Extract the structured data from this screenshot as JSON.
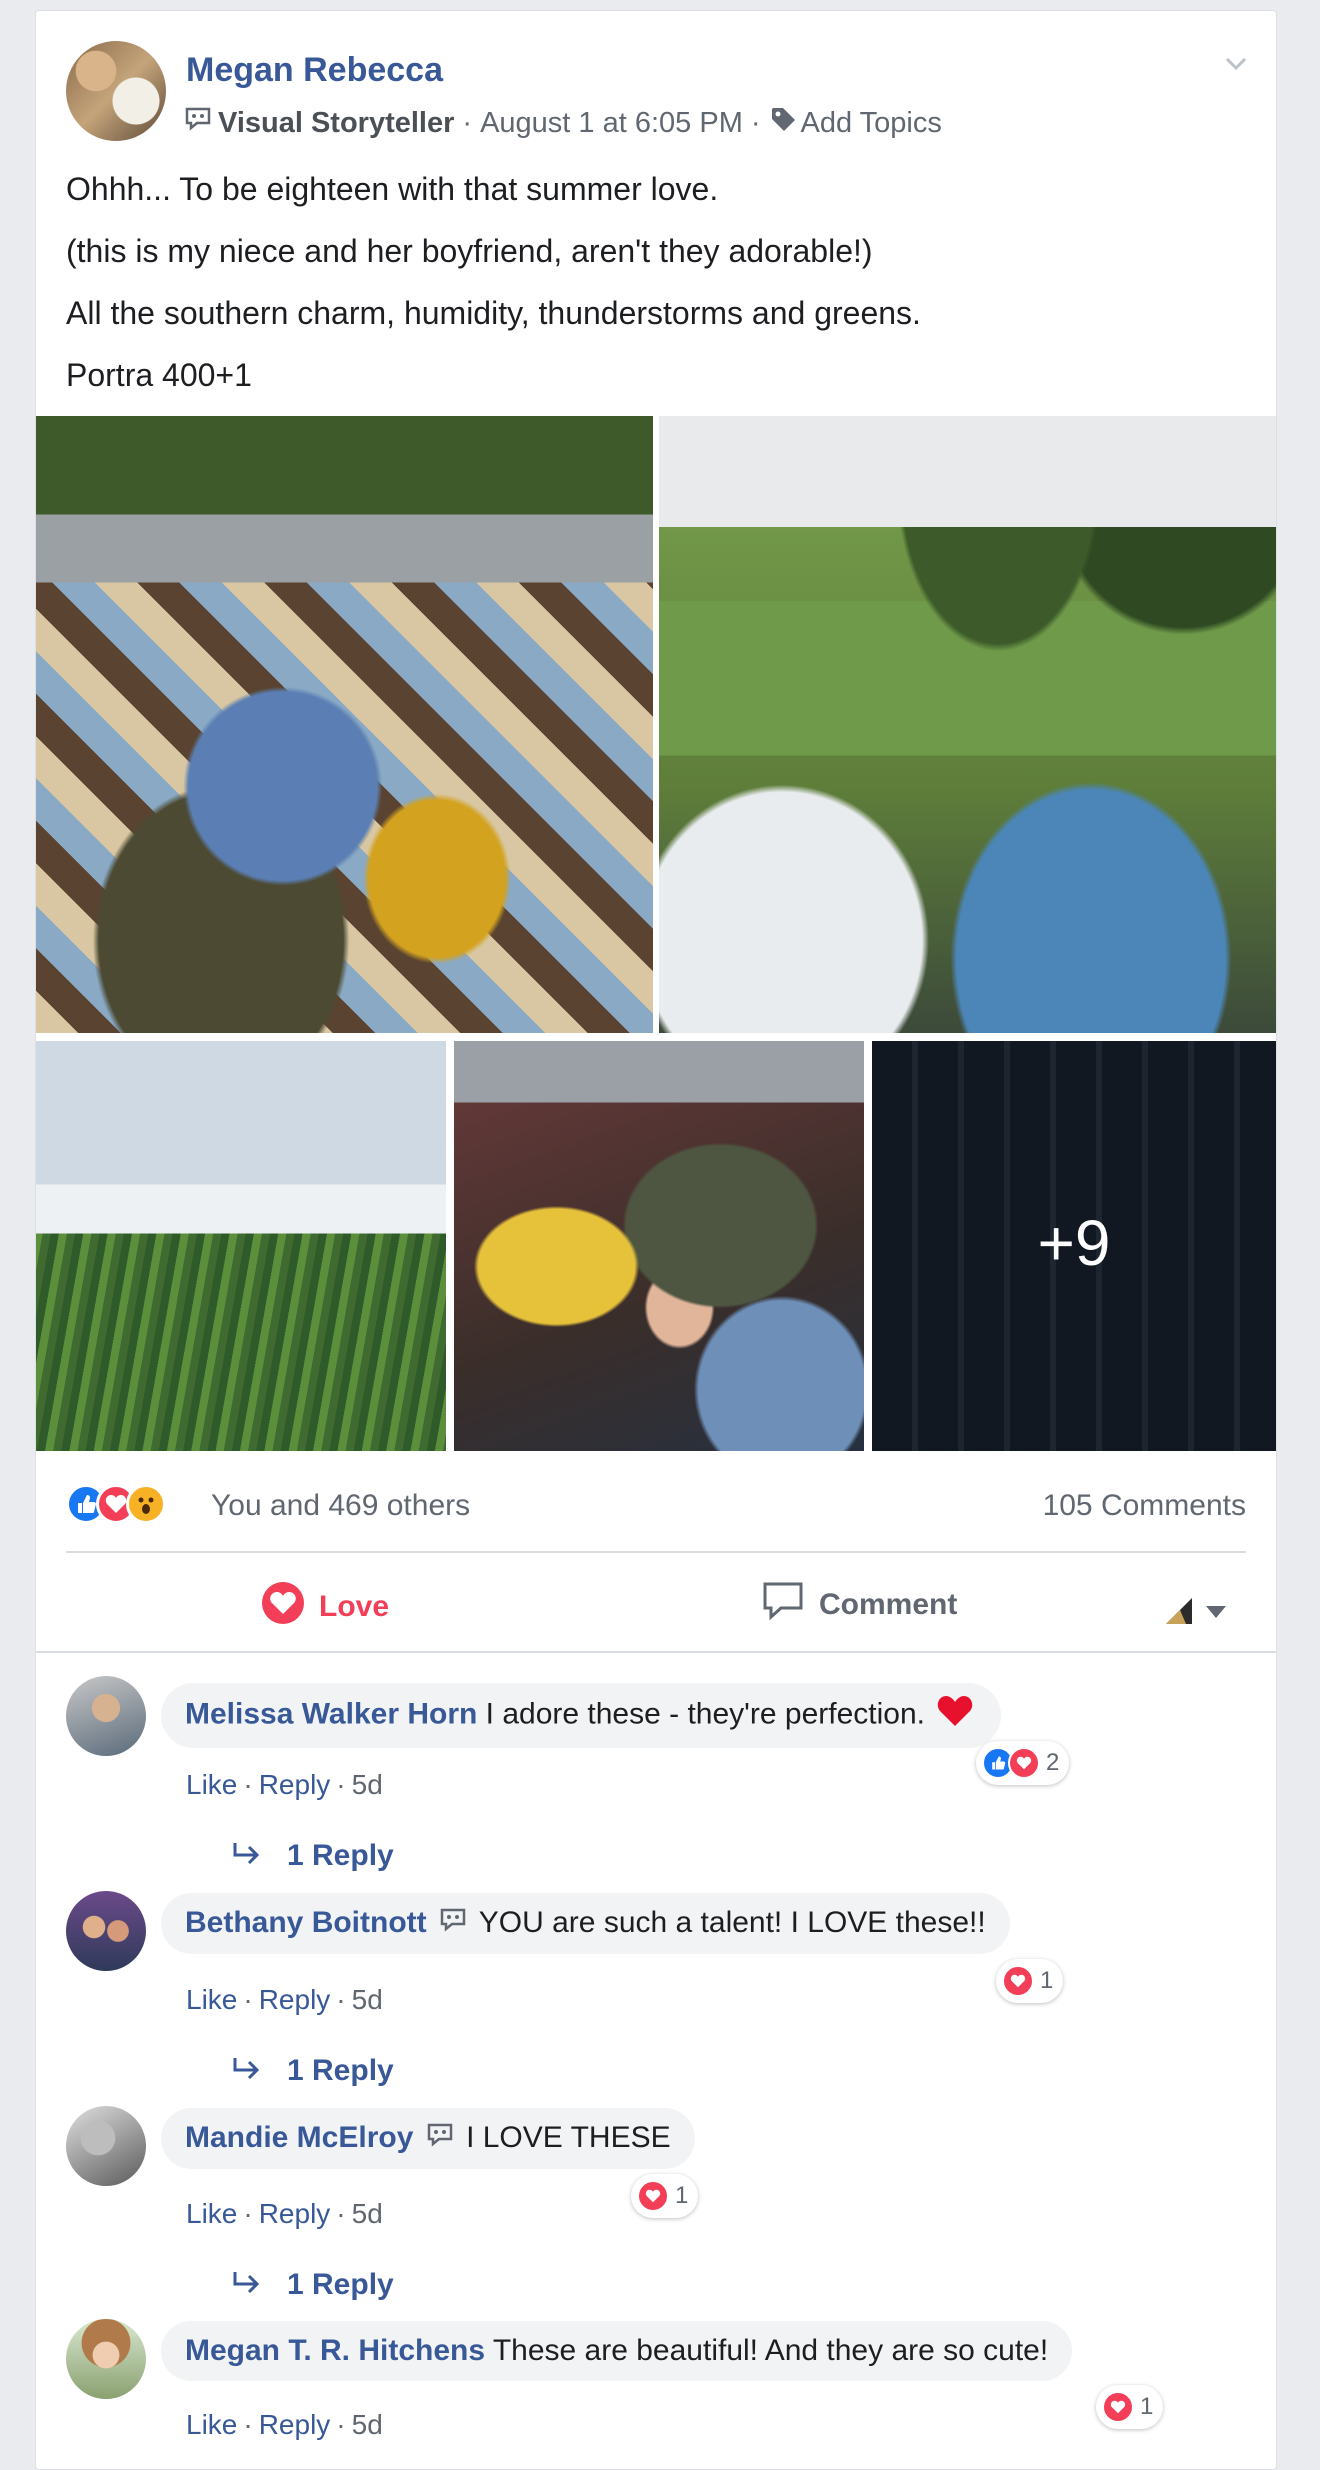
{
  "post": {
    "author": "Megan Rebecca",
    "badge": "Visual Storyteller",
    "separator": "·",
    "timestamp": "August 1 at 6:05 PM",
    "add_topics": "Add Topics",
    "lines": [
      "Ohhh... To be eighteen with that summer love.",
      "(this is my niece and her boyfriend, aren't they adorable!)",
      "All the southern charm, humidity, thunderstorms and greens.",
      "Portra 400+1"
    ],
    "more_photos": "+9"
  },
  "reactions": {
    "icons": [
      "like-icon",
      "love-icon",
      "wow-icon"
    ],
    "summary": "You and 469 others",
    "comments_count": "105 Comments"
  },
  "actions": {
    "love_label": "Love",
    "comment_label": "Comment"
  },
  "comments": [
    {
      "name": "Melissa Walker Horn",
      "text": "I adore these - they're perfection.",
      "has_heart": true,
      "like": "Like",
      "reply": "Reply",
      "age": "5d",
      "reaction_count": "2",
      "replies": "1 Reply"
    },
    {
      "name": "Bethany Boitnott",
      "text": "YOU are such a talent! I LOVE these!!",
      "like": "Like",
      "reply": "Reply",
      "age": "5d",
      "reaction_count": "1",
      "replies": "1 Reply"
    },
    {
      "name": "Mandie McElroy",
      "text": "I LOVE THESE",
      "like": "Like",
      "reply": "Reply",
      "age": "5d",
      "reaction_count": "1",
      "replies": "1 Reply"
    },
    {
      "name": "Megan T. R. Hitchens",
      "text": "These are beautiful! And they are so cute!",
      "like": "Like",
      "reply": "Reply",
      "age": "5d",
      "reaction_count": "1"
    }
  ],
  "colors": {
    "link_blue": "#385898",
    "love_red": "#f33e58",
    "like_blue": "#1877f2",
    "wow_yellow": "#f7b125",
    "muted": "#606770"
  }
}
